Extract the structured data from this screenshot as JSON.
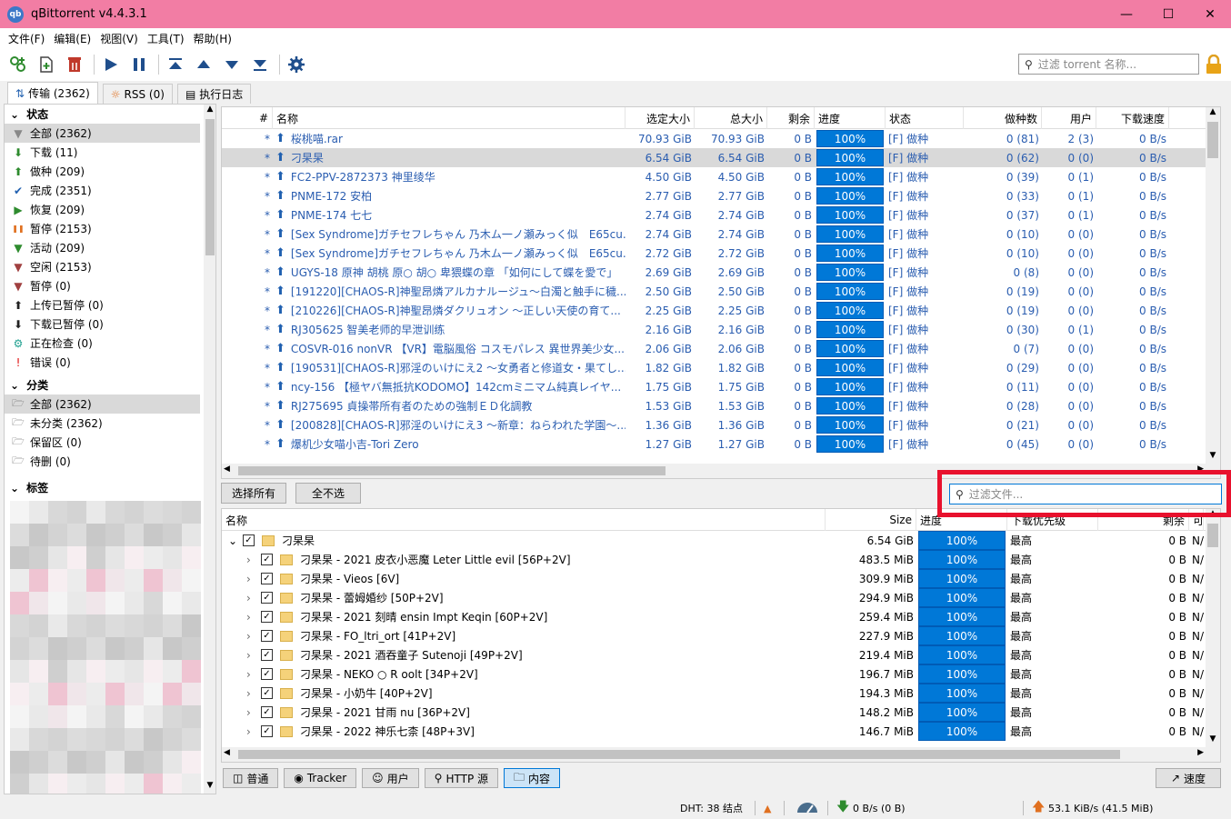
{
  "window": {
    "title": "qBittorrent v4.4.3.1",
    "icon_label": "qb"
  },
  "menu": [
    "文件(F)",
    "编辑(E)",
    "视图(V)",
    "工具(T)",
    "帮助(H)"
  ],
  "toolbar": {
    "filter_placeholder": "过滤 torrent 名称..."
  },
  "side_tabs": [
    {
      "label": "传输 (2362)",
      "icon": "transfer-icon",
      "active": true
    },
    {
      "label": "RSS (0)",
      "icon": "rss-icon",
      "active": false
    },
    {
      "label": "执行日志",
      "icon": "log-icon",
      "active": false
    }
  ],
  "sidebar": {
    "status_title": "状态",
    "status_items": [
      {
        "label": "全部 (2362)",
        "icon": "filter-icon",
        "color": "#888888",
        "sel": true
      },
      {
        "label": "下载 (11)",
        "icon": "download-arrow-icon",
        "color": "#2e8b2e"
      },
      {
        "label": "做种 (209)",
        "icon": "upload-arrow-icon",
        "color": "#2e8b2e"
      },
      {
        "label": "完成 (2351)",
        "icon": "checkmark-icon",
        "color": "#2060b0"
      },
      {
        "label": "恢复 (209)",
        "icon": "play-icon",
        "color": "#2e8b2e"
      },
      {
        "label": "暂停 (2153)",
        "icon": "pause-icon",
        "color": "#e07020"
      },
      {
        "label": "活动 (209)",
        "icon": "filter-green-icon",
        "color": "#2e8b2e"
      },
      {
        "label": "空闲 (2153)",
        "icon": "filter-red-icon",
        "color": "#a04040"
      },
      {
        "label": "暂停 (0)",
        "icon": "filter-red-icon",
        "color": "#a04040"
      },
      {
        "label": "上传已暂停 (0)",
        "icon": "up-paused-icon",
        "color": "#222222"
      },
      {
        "label": "下载已暂停 (0)",
        "icon": "down-paused-icon",
        "color": "#222222"
      },
      {
        "label": "正在检查 (0)",
        "icon": "gear-check-icon",
        "color": "#20a090"
      },
      {
        "label": "错误 (0)",
        "icon": "error-icon",
        "color": "#e01010"
      }
    ],
    "category_title": "分类",
    "category_items": [
      {
        "label": "全部 (2362)",
        "sel": true
      },
      {
        "label": "未分类 (2362)"
      },
      {
        "label": "保留区 (0)"
      },
      {
        "label": "待删 (0)"
      }
    ],
    "tags_title": "标签"
  },
  "torrent_table": {
    "headers": [
      "#",
      "名称",
      "选定大小",
      "总大小",
      "剩余",
      "进度",
      "状态",
      "做种数",
      "用户",
      "下载速度"
    ],
    "rows": [
      {
        "pri": "*",
        "name": "桜桃喵.rar",
        "size": "70.93 GiB",
        "total": "70.93 GiB",
        "left": "0 B",
        "progress": "100%",
        "status": "[F] 做种",
        "seeds": "0 (81)",
        "peers": "2 (3)",
        "speed": "0 B/s"
      },
      {
        "pri": "*",
        "name": "刁杲杲",
        "size": "6.54 GiB",
        "total": "6.54 GiB",
        "left": "0 B",
        "progress": "100%",
        "status": "[F] 做种",
        "seeds": "0 (62)",
        "peers": "0 (0)",
        "speed": "0 B/s",
        "sel": true
      },
      {
        "pri": "*",
        "name": "FC2-PPV-2872373 神里绫华",
        "size": "4.50 GiB",
        "total": "4.50 GiB",
        "left": "0 B",
        "progress": "100%",
        "status": "[F] 做种",
        "seeds": "0 (39)",
        "peers": "0 (1)",
        "speed": "0 B/s"
      },
      {
        "pri": "*",
        "name": "PNME-172 安柏",
        "size": "2.77 GiB",
        "total": "2.77 GiB",
        "left": "0 B",
        "progress": "100%",
        "status": "[F] 做种",
        "seeds": "0 (33)",
        "peers": "0 (1)",
        "speed": "0 B/s"
      },
      {
        "pri": "*",
        "name": "PNME-174 七七",
        "size": "2.74 GiB",
        "total": "2.74 GiB",
        "left": "0 B",
        "progress": "100%",
        "status": "[F] 做种",
        "seeds": "0 (37)",
        "peers": "0 (1)",
        "speed": "0 B/s"
      },
      {
        "pri": "*",
        "name": "[Sex Syndrome]ガチセフレちゃん 乃木ム一ノ瀬みっく似　E65cu...",
        "size": "2.74 GiB",
        "total": "2.74 GiB",
        "left": "0 B",
        "progress": "100%",
        "status": "[F] 做种",
        "seeds": "0 (10)",
        "peers": "0 (0)",
        "speed": "0 B/s"
      },
      {
        "pri": "*",
        "name": "[Sex Syndrome]ガチセフレちゃん 乃木ム一ノ瀬みっく似　E65cu...",
        "size": "2.72 GiB",
        "total": "2.72 GiB",
        "left": "0 B",
        "progress": "100%",
        "status": "[F] 做种",
        "seeds": "0 (10)",
        "peers": "0 (0)",
        "speed": "0 B/s"
      },
      {
        "pri": "*",
        "name": "UGYS-18 原神 胡桃 原○ 胡○ 卑猥蝶の章 「如何にして蝶を愛で」",
        "size": "2.69 GiB",
        "total": "2.69 GiB",
        "left": "0 B",
        "progress": "100%",
        "status": "[F] 做种",
        "seeds": "0 (8)",
        "peers": "0 (0)",
        "speed": "0 B/s"
      },
      {
        "pri": "*",
        "name": "[191220][CHAOS-R]神聖昂燐アルカナルージュ～白濁と触手に穢...",
        "size": "2.50 GiB",
        "total": "2.50 GiB",
        "left": "0 B",
        "progress": "100%",
        "status": "[F] 做种",
        "seeds": "0 (19)",
        "peers": "0 (0)",
        "speed": "0 B/s"
      },
      {
        "pri": "*",
        "name": "[210226][CHAOS-R]神聖昂燐ダクリュオン ～正しい天使の育て...",
        "size": "2.25 GiB",
        "total": "2.25 GiB",
        "left": "0 B",
        "progress": "100%",
        "status": "[F] 做种",
        "seeds": "0 (19)",
        "peers": "0 (0)",
        "speed": "0 B/s"
      },
      {
        "pri": "*",
        "name": "RJ305625 智美老师的早泄训练",
        "size": "2.16 GiB",
        "total": "2.16 GiB",
        "left": "0 B",
        "progress": "100%",
        "status": "[F] 做种",
        "seeds": "0 (30)",
        "peers": "0 (1)",
        "speed": "0 B/s"
      },
      {
        "pri": "*",
        "name": "COSVR-016 nonVR 【VR】電脳風俗 コスモパレス 異世界美少女...",
        "size": "2.06 GiB",
        "total": "2.06 GiB",
        "left": "0 B",
        "progress": "100%",
        "status": "[F] 做种",
        "seeds": "0 (7)",
        "peers": "0 (0)",
        "speed": "0 B/s"
      },
      {
        "pri": "*",
        "name": "[190531][CHAOS-R]邪淫のいけにえ2 ～女勇者と修道女・果てし...",
        "size": "1.82 GiB",
        "total": "1.82 GiB",
        "left": "0 B",
        "progress": "100%",
        "status": "[F] 做种",
        "seeds": "0 (29)",
        "peers": "0 (0)",
        "speed": "0 B/s"
      },
      {
        "pri": "*",
        "name": "ncy-156 【極ヤバ無抵抗KODOMO】142cmミニマム純真レイヤ...",
        "size": "1.75 GiB",
        "total": "1.75 GiB",
        "left": "0 B",
        "progress": "100%",
        "status": "[F] 做种",
        "seeds": "0 (11)",
        "peers": "0 (0)",
        "speed": "0 B/s"
      },
      {
        "pri": "*",
        "name": "RJ275695 貞操帯所有者のための強制ＥＤ化調教",
        "size": "1.53 GiB",
        "total": "1.53 GiB",
        "left": "0 B",
        "progress": "100%",
        "status": "[F] 做种",
        "seeds": "0 (28)",
        "peers": "0 (0)",
        "speed": "0 B/s"
      },
      {
        "pri": "*",
        "name": "[200828][CHAOS-R]邪淫のいけにえ3 ～新章：ねらわれた学園～...",
        "size": "1.36 GiB",
        "total": "1.36 GiB",
        "left": "0 B",
        "progress": "100%",
        "status": "[F] 做种",
        "seeds": "0 (21)",
        "peers": "0 (0)",
        "speed": "0 B/s"
      },
      {
        "pri": "*",
        "name": "爆机少女喵小吉-Tori Zero",
        "size": "1.27 GiB",
        "total": "1.27 GiB",
        "left": "0 B",
        "progress": "100%",
        "status": "[F] 做种",
        "seeds": "0 (45)",
        "peers": "0 (0)",
        "speed": "0 B/s"
      }
    ]
  },
  "content_buttons": {
    "select_all": "选择所有",
    "select_none": "全不选",
    "filter_placeholder": "过滤文件..."
  },
  "file_table": {
    "headers": [
      "名称",
      "Size",
      "进度",
      "下载优先级",
      "剩余",
      "可"
    ],
    "root": {
      "name": "刁杲杲",
      "size": "6.54 GiB",
      "progress": "100%",
      "priority": "最高",
      "left": "0 B",
      "avail": "N/"
    },
    "rows": [
      {
        "name": "刁杲杲 - 2021 皮衣小恶魔 Leter Little evil [56P+2V]",
        "size": "483.5 MiB"
      },
      {
        "name": "刁杲杲 - Vieos [6V]",
        "size": "309.9 MiB"
      },
      {
        "name": "刁杲杲 - 蕾姆婚纱 [50P+2V]",
        "size": "294.9 MiB"
      },
      {
        "name": "刁杲杲 - 2021 刻晴 ensin Impt Keqin  [60P+2V]",
        "size": "259.4 MiB"
      },
      {
        "name": "刁杲杲 - FO_ltri_ort [41P+2V]",
        "size": "227.9 MiB"
      },
      {
        "name": "刁杲杲 - 2021 酒吞童子 Sutenoji  [49P+2V]",
        "size": "219.4 MiB"
      },
      {
        "name": "刁杲杲 - NEKO ○ R oolt [34P+2V]",
        "size": "196.7 MiB"
      },
      {
        "name": "刁杲杲 - 小奶牛  [40P+2V]",
        "size": "194.3 MiB"
      },
      {
        "name": "刁杲杲 - 2021 甘雨 nu [36P+2V]",
        "size": "148.2 MiB"
      },
      {
        "name": "刁杲杲 - 2022 神乐七柰 [48P+3V]",
        "size": "146.7 MiB"
      }
    ],
    "row_progress": "100%",
    "row_priority": "最高",
    "row_left": "0 B",
    "row_avail": "N/"
  },
  "bottom_tabs": [
    {
      "label": "普通",
      "icon": "general-icon"
    },
    {
      "label": "Tracker",
      "icon": "tracker-icon"
    },
    {
      "label": "用户",
      "icon": "users-icon"
    },
    {
      "label": "HTTP 源",
      "icon": "http-source-icon"
    },
    {
      "label": "内容",
      "icon": "folder-icon",
      "active": true
    }
  ],
  "speed_button": "速度",
  "status_bar": {
    "dht": "DHT: 38 结点",
    "download": "0 B/s (0 B)",
    "upload": "53.1 KiB/s (41.5 MiB)"
  },
  "colors": {
    "titlebar": "#f27da4",
    "progress": "#0078d7",
    "link_text": "#2a5db0",
    "highlight_box": "#e8112d"
  }
}
